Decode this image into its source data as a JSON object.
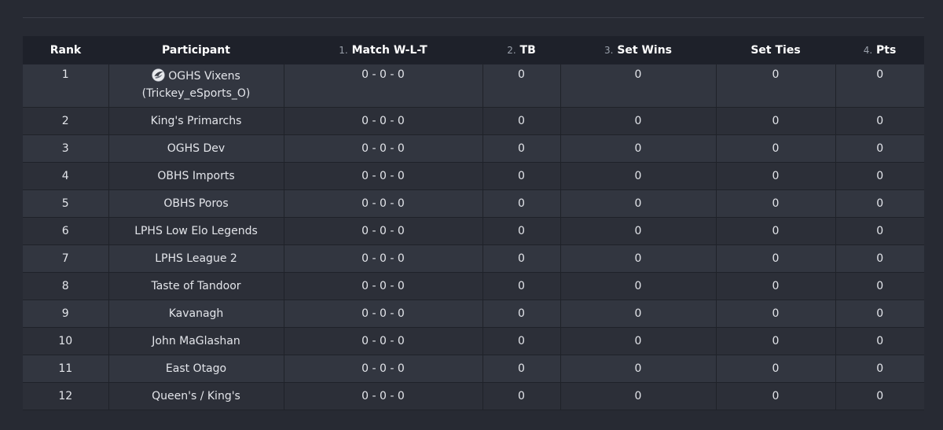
{
  "columns": {
    "rank": "Rank",
    "participant": "Participant",
    "match_wlt": {
      "num": "1.",
      "label": "Match W-L-T"
    },
    "tb": {
      "num": "2.",
      "label": "TB"
    },
    "set_wins": {
      "num": "3.",
      "label": "Set Wins"
    },
    "set_ties": "Set Ties",
    "pts": {
      "num": "4.",
      "label": "Pts"
    }
  },
  "rows": [
    {
      "rank": "1",
      "participant": "OGHS Vixens",
      "participant_sub": "(Trickey_eSports_O)",
      "has_logo": true,
      "logo_icon": "team-logo-icon",
      "match_wlt": "0 - 0 - 0",
      "tb": "0",
      "set_wins": "0",
      "set_ties": "0",
      "pts": "0"
    },
    {
      "rank": "2",
      "participant": "King's Primarchs",
      "match_wlt": "0 - 0 - 0",
      "tb": "0",
      "set_wins": "0",
      "set_ties": "0",
      "pts": "0"
    },
    {
      "rank": "3",
      "participant": "OGHS Dev",
      "match_wlt": "0 - 0 - 0",
      "tb": "0",
      "set_wins": "0",
      "set_ties": "0",
      "pts": "0"
    },
    {
      "rank": "4",
      "participant": "OBHS Imports",
      "match_wlt": "0 - 0 - 0",
      "tb": "0",
      "set_wins": "0",
      "set_ties": "0",
      "pts": "0"
    },
    {
      "rank": "5",
      "participant": "OBHS Poros",
      "match_wlt": "0 - 0 - 0",
      "tb": "0",
      "set_wins": "0",
      "set_ties": "0",
      "pts": "0"
    },
    {
      "rank": "6",
      "participant": "LPHS Low Elo Legends",
      "match_wlt": "0 - 0 - 0",
      "tb": "0",
      "set_wins": "0",
      "set_ties": "0",
      "pts": "0"
    },
    {
      "rank": "7",
      "participant": "LPHS League 2",
      "match_wlt": "0 - 0 - 0",
      "tb": "0",
      "set_wins": "0",
      "set_ties": "0",
      "pts": "0"
    },
    {
      "rank": "8",
      "participant": "Taste of Tandoor",
      "match_wlt": "0 - 0 - 0",
      "tb": "0",
      "set_wins": "0",
      "set_ties": "0",
      "pts": "0"
    },
    {
      "rank": "9",
      "participant": "Kavanagh",
      "match_wlt": "0 - 0 - 0",
      "tb": "0",
      "set_wins": "0",
      "set_ties": "0",
      "pts": "0"
    },
    {
      "rank": "10",
      "participant": "John MaGlashan",
      "match_wlt": "0 - 0 - 0",
      "tb": "0",
      "set_wins": "0",
      "set_ties": "0",
      "pts": "0"
    },
    {
      "rank": "11",
      "participant": "East Otago",
      "match_wlt": "0 - 0 - 0",
      "tb": "0",
      "set_wins": "0",
      "set_ties": "0",
      "pts": "0"
    },
    {
      "rank": "12",
      "participant": "Queen's / King's",
      "match_wlt": "0 - 0 - 0",
      "tb": "0",
      "set_wins": "0",
      "set_ties": "0",
      "pts": "0"
    }
  ]
}
